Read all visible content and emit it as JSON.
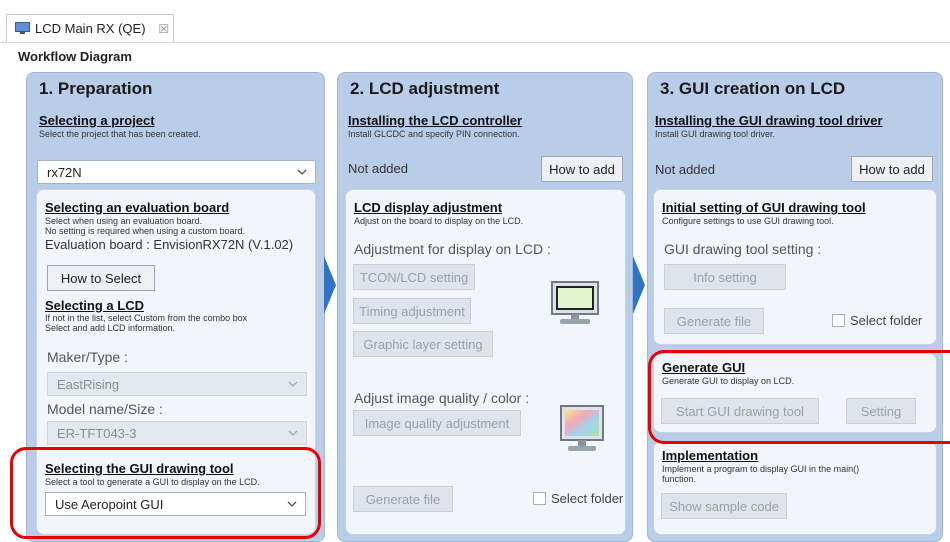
{
  "tab": {
    "title": "LCD Main RX (QE)",
    "close": "☒"
  },
  "workflow_title": "Workflow Diagram",
  "col1": {
    "title": "1. Preparation",
    "project": {
      "title": "Selecting a project",
      "desc": "Select the project that has been created.",
      "value": "rx72N"
    },
    "board": {
      "title": "Selecting an evaluation board",
      "desc1": "Select when using an evaluation board.",
      "desc2": "No setting is required when using a custom board.",
      "value": "Evaluation board : EnvisionRX72N (V.1.02)",
      "button": "How to Select"
    },
    "lcd": {
      "title": "Selecting a LCD",
      "desc1": "If not in the list, select Custom from the combo box",
      "desc2": "Select and add LCD information.",
      "maker_label": "Maker/Type :",
      "maker_value": "EastRising",
      "model_label": "Model name/Size :",
      "model_value": "ER-TFT043-3"
    },
    "gui_tool": {
      "title": "Selecting the GUI drawing tool",
      "desc": "Select a tool to generate a GUI to display on the LCD.",
      "value": "Use Aeropoint GUI"
    }
  },
  "col2": {
    "title": "2. LCD adjustment",
    "controller": {
      "title": "Installing the LCD controller",
      "desc": "Install GLCDC and specify PIN connection.",
      "status": "Not added",
      "button": "How to add"
    },
    "display": {
      "title": "LCD display adjustment",
      "desc": "Adjust on the board to display on the LCD.",
      "label": "Adjustment for display on LCD :",
      "btn_tcon": "TCON/LCD setting",
      "btn_timing": "Timing adjustment",
      "btn_graphic": "Graphic layer setting",
      "quality_label": "Adjust image quality / color :",
      "btn_quality": "Image quality adjustment",
      "btn_generate": "Generate file",
      "select_folder": "Select folder"
    }
  },
  "col3": {
    "title": "3. GUI creation on LCD",
    "driver": {
      "title": "Installing the GUI drawing tool driver",
      "desc": "Install GUI drawing tool driver.",
      "status": "Not added",
      "button": "How to add"
    },
    "initial": {
      "title": "Initial setting of GUI drawing tool",
      "desc": "Configure settings to use GUI drawing tool.",
      "label": "GUI drawing tool setting :",
      "btn_info": "Info setting",
      "btn_generate": "Generate file",
      "select_folder": "Select folder"
    },
    "generate": {
      "title": "Generate GUI",
      "desc": "Generate GUI to display on LCD.",
      "btn_start": "Start GUI drawing tool",
      "btn_setting": "Setting"
    },
    "implementation": {
      "title": "Implementation",
      "desc1": "Implement a program to display GUI in the main()",
      "desc2": "function.",
      "btn_sample": "Show sample code"
    }
  },
  "colors": {
    "column_bg": "#b9cde8",
    "inner_bg": "#f2f6fc",
    "arrow": "#2f74c5",
    "highlight": "#e60000"
  }
}
